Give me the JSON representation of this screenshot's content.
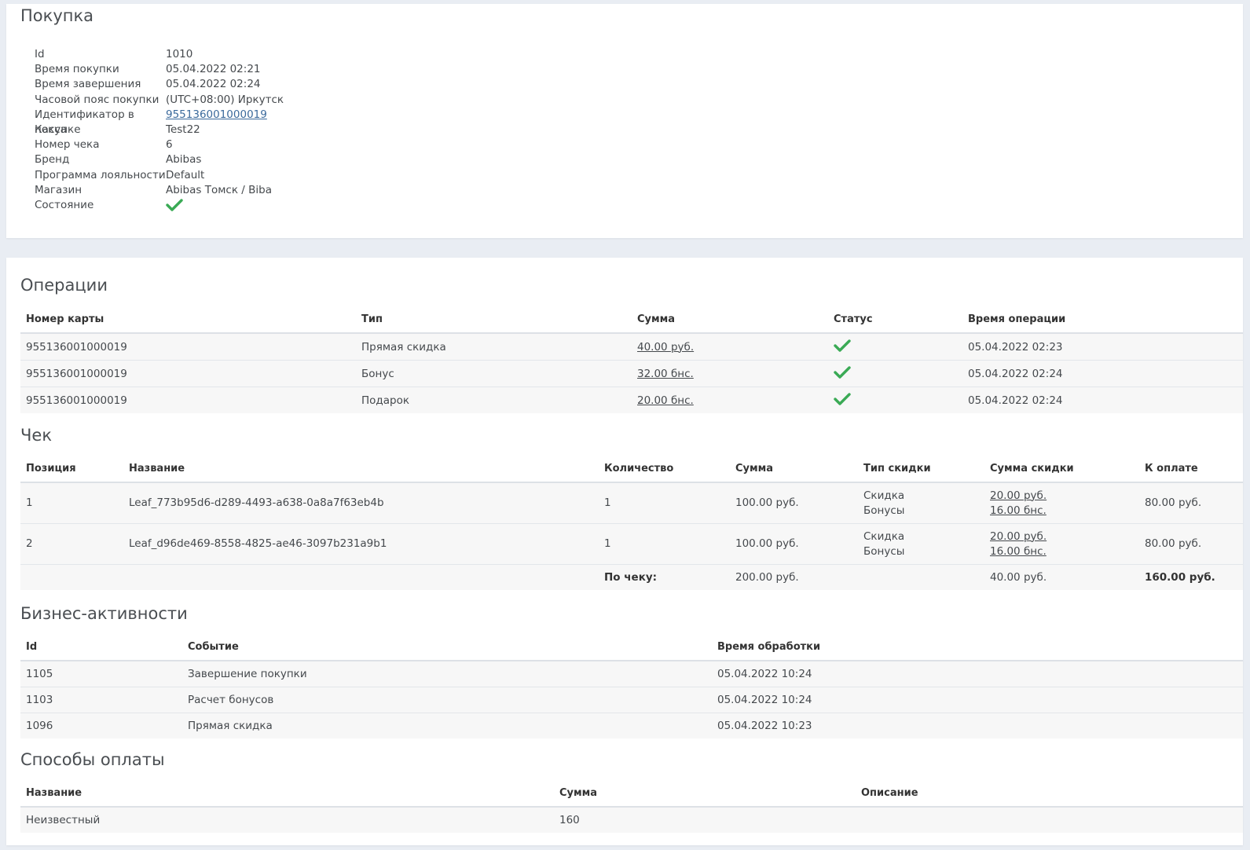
{
  "purchase": {
    "title": "Покупка",
    "fields": [
      {
        "label": "Id",
        "value": "1010"
      },
      {
        "label": "Время покупки",
        "value": "05.04.2022 02:21"
      },
      {
        "label": "Время завершения",
        "value": "05.04.2022 02:24"
      },
      {
        "label": "Часовой пояс покупки",
        "value": "(UTC+08:00) Иркутск"
      },
      {
        "label": "Идентификатор в покупке",
        "value": "955136001000019"
      },
      {
        "label": "Касса",
        "value": "Test22"
      },
      {
        "label": "Номер чека",
        "value": "6"
      },
      {
        "label": "Бренд",
        "value": "Abibas"
      },
      {
        "label": "Программа лояльности",
        "value": "Default"
      },
      {
        "label": "Магазин",
        "value": "Abibas Томск / Biba"
      },
      {
        "label": "Состояние",
        "icon": "check-icon"
      }
    ]
  },
  "operations": {
    "title": "Операции",
    "headers": [
      "Номер карты",
      "Тип",
      "Сумма",
      "Статус",
      "Время операции"
    ],
    "rows": [
      {
        "card": "955136001000019",
        "type": "Прямая скидка",
        "amount": "40.00 руб.",
        "status_icon": "check-icon",
        "time": "05.04.2022 02:23"
      },
      {
        "card": "955136001000019",
        "type": "Бонус",
        "amount": "32.00 бнс.",
        "status_icon": "check-icon",
        "time": "05.04.2022 02:24"
      },
      {
        "card": "955136001000019",
        "type": "Подарок",
        "amount": "20.00 бнс.",
        "status_icon": "check-icon",
        "time": "05.04.2022 02:24"
      }
    ]
  },
  "receipt": {
    "title": "Чек",
    "headers": [
      "Позиция",
      "Название",
      "Количество",
      "Сумма",
      "Тип скидки",
      "Сумма скидки",
      "К оплате"
    ],
    "rows": [
      {
        "pos": "1",
        "name": "Leaf_773b95d6-d289-4493-a638-0a8a7f63eb4b",
        "qty": "1",
        "sum": "100.00 руб.",
        "discount_type_1": "Скидка",
        "discount_type_2": "Бонусы",
        "discount_sum_1": "20.00 руб.",
        "discount_sum_2": "16.00 бнс.",
        "to_pay": "80.00 руб."
      },
      {
        "pos": "2",
        "name": "Leaf_d96de469-8558-4825-ae46-3097b231a9b1",
        "qty": "1",
        "sum": "100.00 руб.",
        "discount_type_1": "Скидка",
        "discount_type_2": "Бонусы",
        "discount_sum_1": "20.00 руб.",
        "discount_sum_2": "16.00 бнс.",
        "to_pay": "80.00 руб."
      }
    ],
    "total": {
      "label": "По чеку:",
      "sum": "200.00 руб.",
      "discount": "40.00 руб.",
      "to_pay": "160.00 руб."
    }
  },
  "business": {
    "title": "Бизнес-активности",
    "headers": [
      "Id",
      "Событие",
      "Время обработки"
    ],
    "rows": [
      {
        "id": "1105",
        "event": "Завершение покупки",
        "time": "05.04.2022 10:24"
      },
      {
        "id": "1103",
        "event": "Расчет бонусов",
        "time": "05.04.2022 10:24"
      },
      {
        "id": "1096",
        "event": "Прямая скидка",
        "time": "05.04.2022 10:23"
      }
    ]
  },
  "payment": {
    "title": "Способы оплаты",
    "headers": [
      "Название",
      "Сумма",
      "Описание"
    ],
    "rows": [
      {
        "name": "Неизвестный",
        "sum": "160",
        "description": ""
      }
    ]
  },
  "colors": {
    "check": "#3aaa55",
    "link": "#3b6a9c",
    "background": "#e9edf3"
  }
}
